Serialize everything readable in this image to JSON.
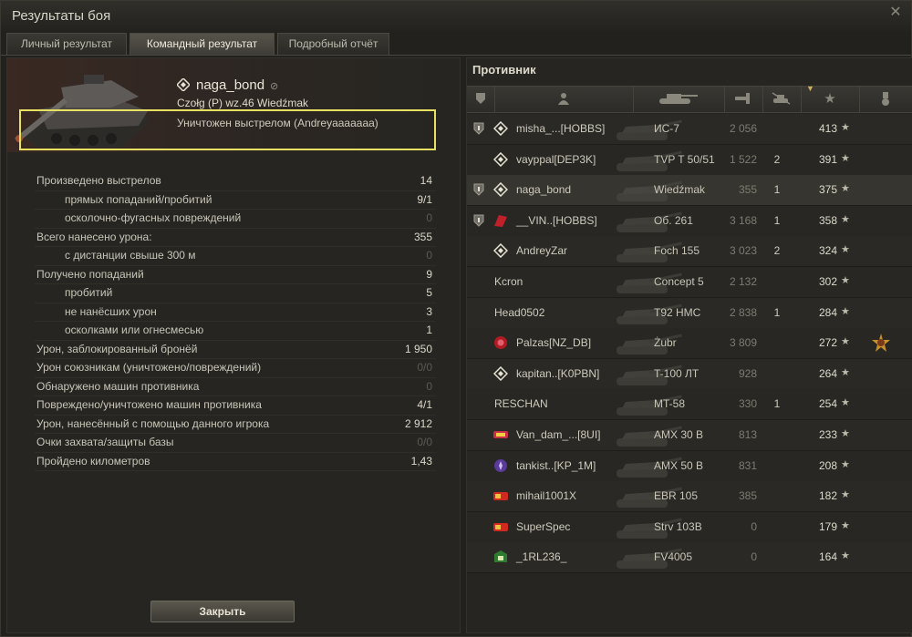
{
  "window": {
    "title": "Результаты боя"
  },
  "tabs": [
    {
      "label": "Личный результат",
      "active": false
    },
    {
      "label": "Командный результат",
      "active": true
    },
    {
      "label": "Подробный отчёт",
      "active": false
    }
  ],
  "player": {
    "name": "naga_bond",
    "vehicle": "Czołg (P) wz.46 Wiedźmak",
    "destroyed_by": "Уничтожен выстрелом (Andreyaaaaaaa)"
  },
  "stats": [
    {
      "label": "Произведено выстрелов",
      "value": "14",
      "sub": false,
      "dim": false
    },
    {
      "label": "прямых попаданий/пробитий",
      "value": "9/1",
      "sub": true,
      "dim": false
    },
    {
      "label": "осколочно-фугасных повреждений",
      "value": "0",
      "sub": true,
      "dim": true
    },
    {
      "label": "Всего нанесено урона:",
      "value": "355",
      "sub": false,
      "dim": false
    },
    {
      "label": "с дистанции свыше 300 м",
      "value": "0",
      "sub": true,
      "dim": true
    },
    {
      "label": "Получено попаданий",
      "value": "9",
      "sub": false,
      "dim": false
    },
    {
      "label": "пробитий",
      "value": "5",
      "sub": true,
      "dim": false
    },
    {
      "label": "не нанёсших урон",
      "value": "3",
      "sub": true,
      "dim": false
    },
    {
      "label": "осколками или огнесмесью",
      "value": "1",
      "sub": true,
      "dim": false
    },
    {
      "label": "Урон, заблокированный бронёй",
      "value": "1 950",
      "sub": false,
      "dim": false
    },
    {
      "label": "Урон союзникам (уничтожено/повреждений)",
      "value": "0/0",
      "sub": false,
      "dim": true
    },
    {
      "label": "Обнаружено машин противника",
      "value": "0",
      "sub": false,
      "dim": true
    },
    {
      "label": "Повреждено/уничтожено машин противника",
      "value": "4/1",
      "sub": false,
      "dim": false
    },
    {
      "label": "Урон, нанесённый с помощью данного игрока",
      "value": "2 912",
      "sub": false,
      "dim": false
    },
    {
      "label": "Очки захвата/защиты базы",
      "value": "0/0",
      "sub": false,
      "dim": true
    },
    {
      "label": "Пройдено километров",
      "value": "1,43",
      "sub": false,
      "dim": false
    }
  ],
  "close_button": {
    "label": "Закрыть"
  },
  "enemy": {
    "title": "Противник",
    "players": [
      {
        "name": "misha_...[HOBBS]",
        "tank": "ИС-7",
        "damage": "2 056",
        "kills": "",
        "xp": "413",
        "shield": true,
        "clan": "diamond",
        "me": false,
        "medal": false
      },
      {
        "name": "vayppal[DEP3K]",
        "tank": "TVP T 50/51",
        "damage": "1 522",
        "kills": "2",
        "xp": "391",
        "shield": false,
        "clan": "diamond",
        "me": false,
        "medal": false
      },
      {
        "name": "naga_bond",
        "tank": "Wiedźmak",
        "damage": "355",
        "kills": "1",
        "xp": "375",
        "shield": true,
        "clan": "diamond",
        "me": true,
        "medal": false
      },
      {
        "name": "__VIN..[HOBBS]",
        "tank": "Об. 261",
        "damage": "3 168",
        "kills": "1",
        "xp": "358",
        "shield": true,
        "clan": "red",
        "me": false,
        "medal": false
      },
      {
        "name": "AndreyZar",
        "tank": "Foch 155",
        "damage": "3 023",
        "kills": "2",
        "xp": "324",
        "shield": false,
        "clan": "diamond",
        "me": false,
        "medal": false
      },
      {
        "name": "Kcron",
        "tank": "Concept 5",
        "damage": "2 132",
        "kills": "",
        "xp": "302",
        "shield": false,
        "clan": "",
        "me": false,
        "medal": false
      },
      {
        "name": "Head0502",
        "tank": "T92 HMC",
        "damage": "2 838",
        "kills": "1",
        "xp": "284",
        "shield": false,
        "clan": "",
        "me": false,
        "medal": false
      },
      {
        "name": "Palzas[NZ_DB]",
        "tank": "Żubr",
        "damage": "3 809",
        "kills": "",
        "xp": "272",
        "shield": false,
        "clan": "redcircle",
        "me": false,
        "medal": true
      },
      {
        "name": "kapitan..[K0PBN]",
        "tank": "T-100 ЛТ",
        "damage": "928",
        "kills": "",
        "xp": "264",
        "shield": false,
        "clan": "diamond",
        "me": false,
        "medal": false
      },
      {
        "name": "RESCHAN",
        "tank": "MT-58",
        "damage": "330",
        "kills": "1",
        "xp": "254",
        "shield": false,
        "clan": "",
        "me": false,
        "medal": false
      },
      {
        "name": "Van_dam_...[8UI]",
        "tank": "AMX 30 B",
        "damage": "813",
        "kills": "",
        "xp": "233",
        "shield": false,
        "clan": "logo",
        "me": false,
        "medal": false
      },
      {
        "name": "tankist..[KP_1M]",
        "tank": "AMX 50 B",
        "damage": "831",
        "kills": "",
        "xp": "208",
        "shield": false,
        "clan": "purple",
        "me": false,
        "medal": false
      },
      {
        "name": "mihail1001X",
        "tank": "EBR 105",
        "damage": "385",
        "kills": "",
        "xp": "182",
        "shield": false,
        "clan": "logo2",
        "me": false,
        "medal": false
      },
      {
        "name": "SuperSpec",
        "tank": "Strv 103B",
        "damage": "0",
        "kills": "",
        "xp": "179",
        "shield": false,
        "clan": "logo2",
        "me": false,
        "medal": false
      },
      {
        "name": "_1RL236_",
        "tank": "FV4005",
        "damage": "0",
        "kills": "",
        "xp": "164",
        "shield": false,
        "clan": "green",
        "me": false,
        "medal": false
      }
    ]
  },
  "star_glyph": "★",
  "icons": {
    "close": "close-icon",
    "columns": [
      "shield-icon",
      "player-icon",
      "tank-icon",
      "frags-icon",
      "destroyed-icon",
      "xp-star-icon",
      "medal-icon"
    ]
  }
}
